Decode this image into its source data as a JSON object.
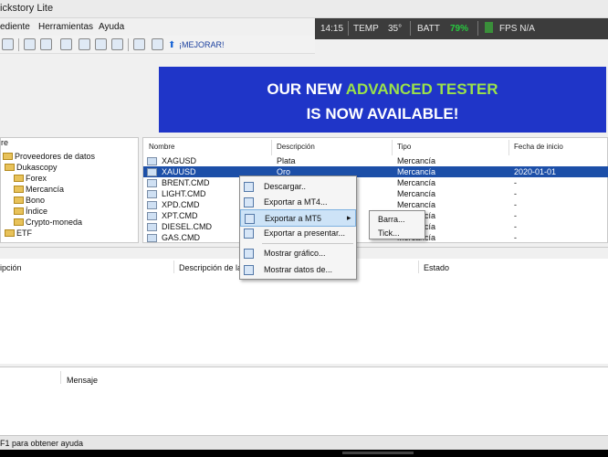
{
  "window": {
    "title": "ickstory Lite"
  },
  "menu": [
    "ediente",
    "Herramientas",
    "Ayuda"
  ],
  "hud": {
    "time": "14:15",
    "temp_label": "TEMP",
    "temp_value": "35°",
    "batt_label": "BATT",
    "batt_value": "79%",
    "fps": "FPS N/A",
    "batt_color": "#27c93f"
  },
  "toolbar": {
    "upgrade_label": "¡MEJORAR!"
  },
  "banner": {
    "line1_a": "OUR NEW ",
    "line1_b": "ADVANCED TESTER",
    "line2": "IS NOW AVAILABLE!",
    "accent": "#9be24a",
    "bg": "#1f35c8"
  },
  "tree": {
    "header": "re",
    "items": [
      "Proveedores de datos",
      "Dukascopy",
      "Forex",
      "Mercancía",
      "Bono",
      "Índice",
      "Crypto-moneda",
      "ETF"
    ]
  },
  "table": {
    "columns": [
      "Nombre",
      "Descripción",
      "Tipo",
      "Fecha de inicio"
    ],
    "rows": [
      {
        "name": "XAGUSD",
        "desc": "Plata",
        "type": "Mercancía",
        "date": ""
      },
      {
        "name": "XAUUSD",
        "desc": "Oro",
        "type": "Mercancía",
        "date": "2020-01-01"
      },
      {
        "name": "BRENT.CMD",
        "desc": "",
        "type": "Mercancía",
        "date": "-"
      },
      {
        "name": "LIGHT.CMD",
        "desc": "",
        "type": "Mercancía",
        "date": "-"
      },
      {
        "name": "XPD.CMD",
        "desc": "",
        "type": "Mercancía",
        "date": "-"
      },
      {
        "name": "XPT.CMD",
        "desc": "",
        "type": "Mercancía",
        "date": "-"
      },
      {
        "name": "DIESEL.CMD",
        "desc": "",
        "type": "Mercancía",
        "date": "-"
      },
      {
        "name": "GAS.CMD",
        "desc": "",
        "type": "Mercancía",
        "date": "-"
      }
    ]
  },
  "context_menu": {
    "items": [
      "Descargar..",
      "Exportar a MT4...",
      "Exportar a MT5",
      "Exportar a presentar...",
      "Mostrar gráfico...",
      "Mostrar datos de..."
    ],
    "submenu_arrow": "▸"
  },
  "submenu": {
    "items": [
      "Barra...",
      "Tick..."
    ]
  },
  "lower": {
    "columns": [
      "ipción",
      "Descripción de la Sit",
      "Estado"
    ]
  },
  "log": {
    "columns": [
      "Mensaje"
    ]
  },
  "status": {
    "text": "F1 para obtener ayuda"
  }
}
